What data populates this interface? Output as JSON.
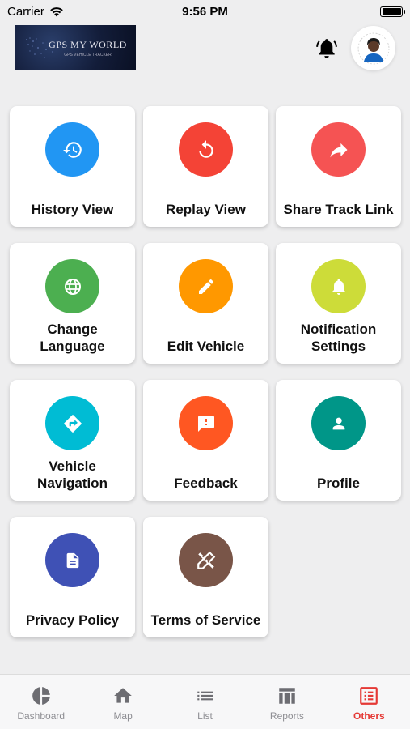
{
  "status_bar": {
    "carrier": "Carrier",
    "time": "9:56 PM"
  },
  "header": {
    "logo_title": "GPS MY WORLD",
    "logo_subtitle": "GPS VEHICLE TRACKER",
    "bell_icon": "bell-icon",
    "avatar": "user-avatar"
  },
  "menu": [
    {
      "id": "history-view",
      "label": "History View",
      "color": "#2196f3",
      "icon": "history-icon"
    },
    {
      "id": "replay-view",
      "label": "Replay View",
      "color": "#f44336",
      "icon": "replay-icon"
    },
    {
      "id": "share-track-link",
      "label": "Share Track Link",
      "color": "#f55353",
      "icon": "share-icon"
    },
    {
      "id": "change-language",
      "label": "Change Language",
      "color": "#4caf50",
      "icon": "globe-icon"
    },
    {
      "id": "edit-vehicle",
      "label": "Edit Vehicle",
      "color": "#ff9800",
      "icon": "pencil-icon"
    },
    {
      "id": "notification-settings",
      "label": "Notification Settings",
      "color": "#cddc39",
      "icon": "bell-settings-icon"
    },
    {
      "id": "vehicle-navigation",
      "label": "Vehicle Navigation",
      "color": "#00bcd4",
      "icon": "directions-icon"
    },
    {
      "id": "feedback",
      "label": "Feedback",
      "color": "#ff5722",
      "icon": "feedback-icon"
    },
    {
      "id": "profile",
      "label": "Profile",
      "color": "#009688",
      "icon": "person-icon"
    },
    {
      "id": "privacy-policy",
      "label": "Privacy Policy",
      "color": "#3f51b5",
      "icon": "document-icon"
    },
    {
      "id": "terms-of-service",
      "label": "Terms of Service",
      "color": "#795548",
      "icon": "tools-icon"
    }
  ],
  "tabs": [
    {
      "id": "dashboard",
      "label": "Dashboard",
      "icon": "pie-chart-icon",
      "active": false
    },
    {
      "id": "map",
      "label": "Map",
      "icon": "home-icon",
      "active": false
    },
    {
      "id": "list",
      "label": "List",
      "icon": "list-icon",
      "active": false
    },
    {
      "id": "reports",
      "label": "Reports",
      "icon": "reports-icon",
      "active": false
    },
    {
      "id": "others",
      "label": "Others",
      "icon": "others-icon",
      "active": true
    }
  ],
  "colors": {
    "active_tab": "#e53935",
    "inactive_tab": "#8e8e93",
    "background": "#eeeeef"
  }
}
